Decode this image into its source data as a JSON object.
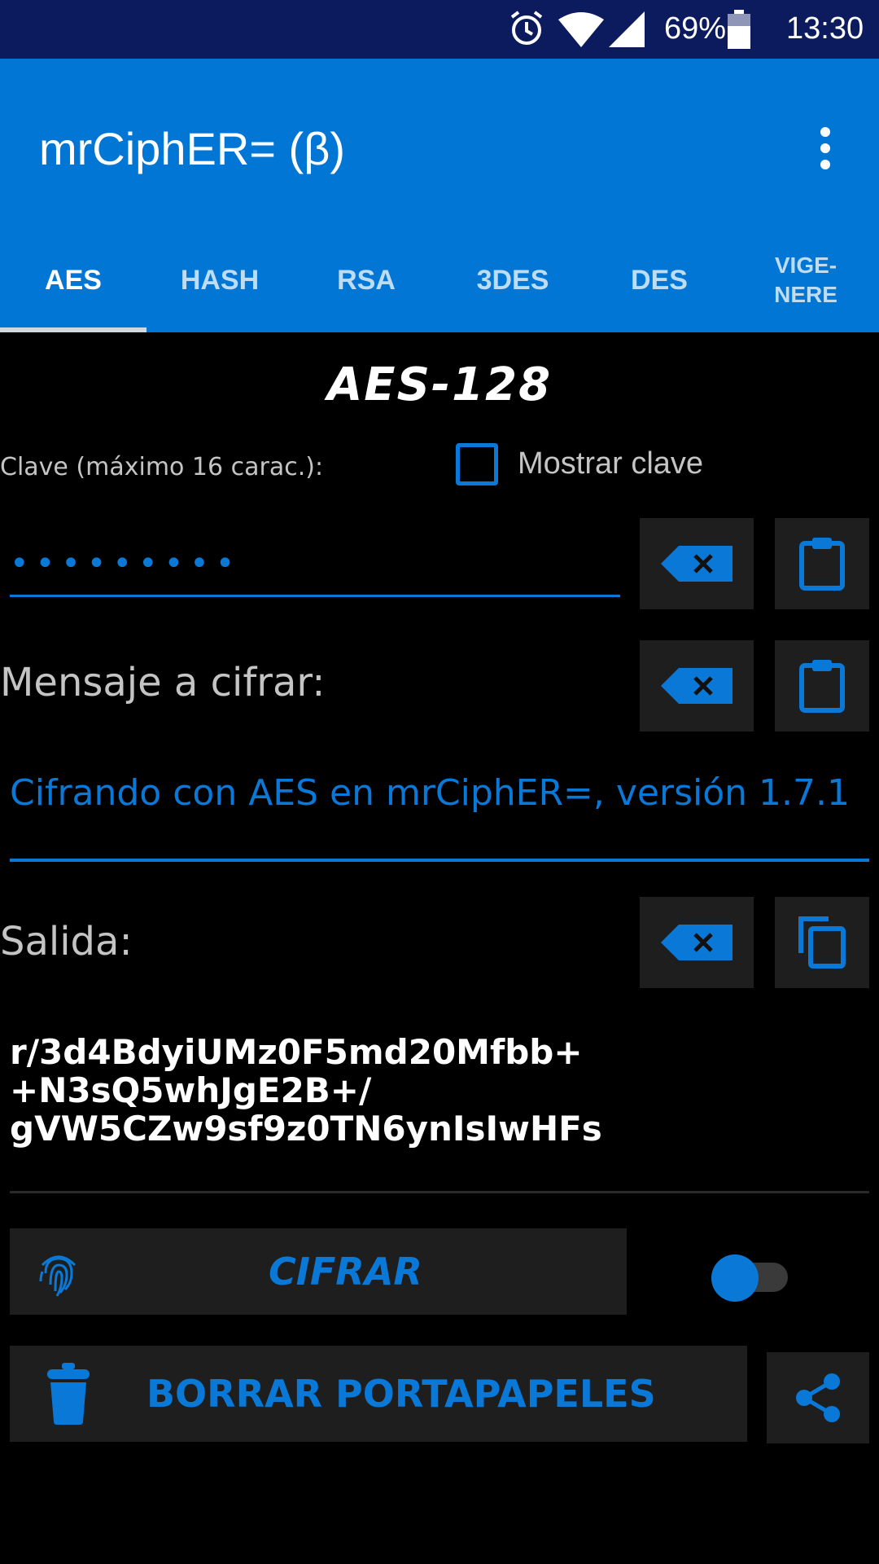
{
  "status_bar": {
    "battery": "69%",
    "time": "13:30"
  },
  "app_bar": {
    "title": "mrCiphER= (β)"
  },
  "tabs": [
    {
      "label": "AES"
    },
    {
      "label": "HASH"
    },
    {
      "label": "RSA"
    },
    {
      "label": "3DES"
    },
    {
      "label": "DES"
    },
    {
      "label": "VIGE-",
      "label2": "NERE"
    }
  ],
  "section_title": "AES-128",
  "key": {
    "label": "Clave (máximo 16 carac.):",
    "show_label": "Mostrar clave",
    "value": "•••••••••"
  },
  "message": {
    "label": "Mensaje a cifrar:",
    "value": "Cifrando con AES en mrCiphER=, versión 1.7.1"
  },
  "output": {
    "label": "Salida:",
    "value_line1": "r/3d4BdyiUMz0F5md20Mfbb+",
    "value_line2": "+N3sQ5whJgE2B+/",
    "value_line3": "gVW5CZw9sf9z0TN6ynIsIwHFs"
  },
  "actions": {
    "encrypt_label": "CIFRAR",
    "clear_clipboard_label": "BORRAR PORTAPAPELES"
  },
  "colors": {
    "accent": "#0a78d6",
    "appbar": "#0176d4",
    "statusbar": "#0c1b5e"
  }
}
